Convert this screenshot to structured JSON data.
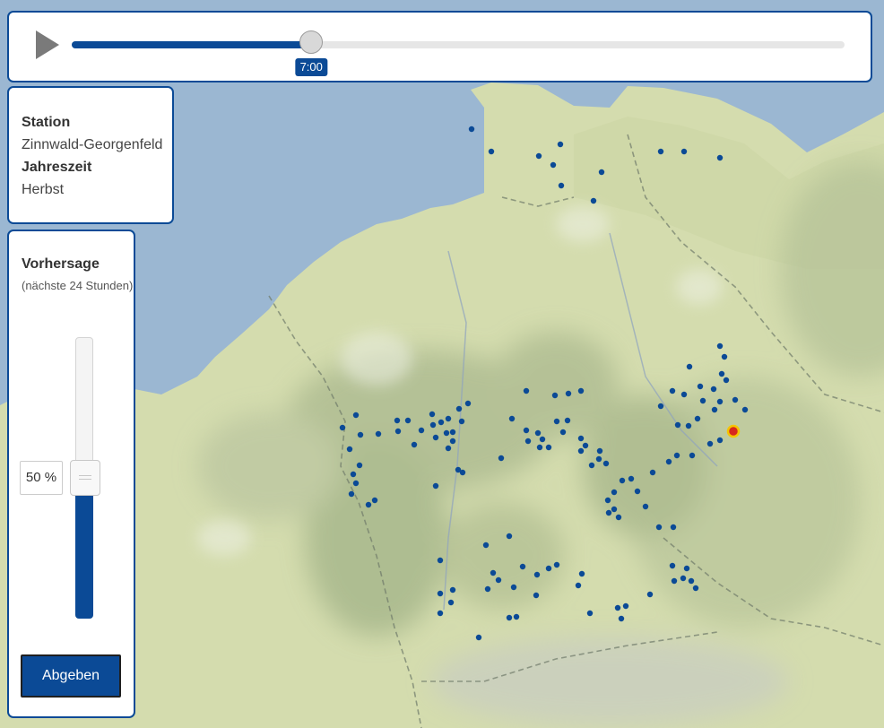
{
  "timeline": {
    "time_label": "7:00",
    "progress": 0.31
  },
  "station_info": {
    "station_heading": "Station",
    "station_name": "Zinnwald-Georgenfeld",
    "season_heading": "Jahreszeit",
    "season": "Herbst"
  },
  "forecast": {
    "title": "Vorhersage",
    "subtitle": "(nächste 24 Stunden)",
    "percent_label": "50 %",
    "percent_value": 50,
    "submit_label": "Abgeben"
  },
  "colors": {
    "accent": "#0b4a96",
    "station_marker": "#0b4a96",
    "selected_marker_fill": "#d7261e",
    "selected_marker_ring": "#f5c400",
    "sea": "#9bb7d2",
    "land": "#d4dcae"
  },
  "selected_station": "Zinnwald-Georgenfeld"
}
